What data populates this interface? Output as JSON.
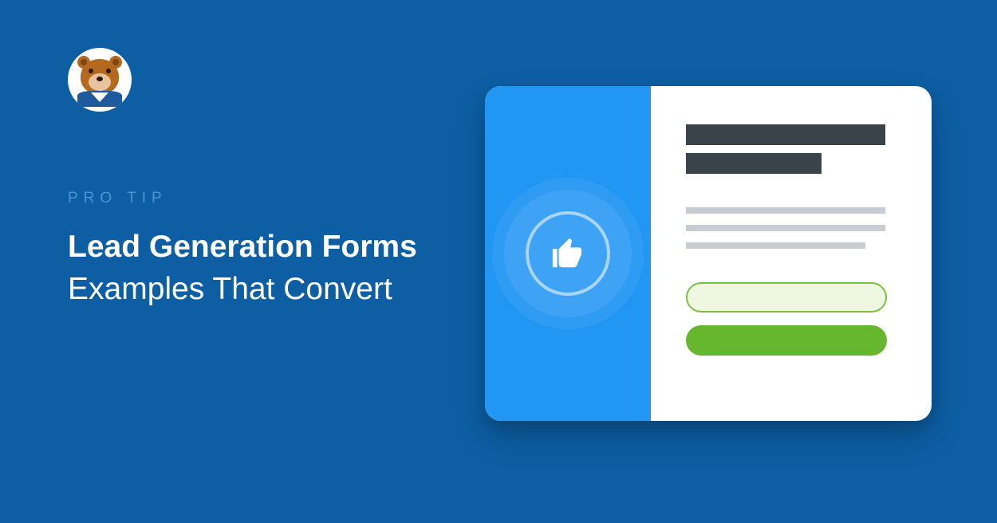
{
  "eyebrow": "PRO TIP",
  "title_line1": "Lead Generation Forms",
  "title_line2": "Examples That Convert",
  "colors": {
    "background": "#0d5ea3",
    "accent_blue": "#2196f3",
    "accent_green": "#66b62e",
    "dark_bar": "#3a424a"
  },
  "logo": {
    "name": "wpforms-mascot",
    "type": "bear-character"
  },
  "card": {
    "icon": "thumbs-up",
    "form_elements": {
      "heading_bars": 2,
      "text_lines": 3,
      "input_fields": 1,
      "buttons": 1
    }
  }
}
